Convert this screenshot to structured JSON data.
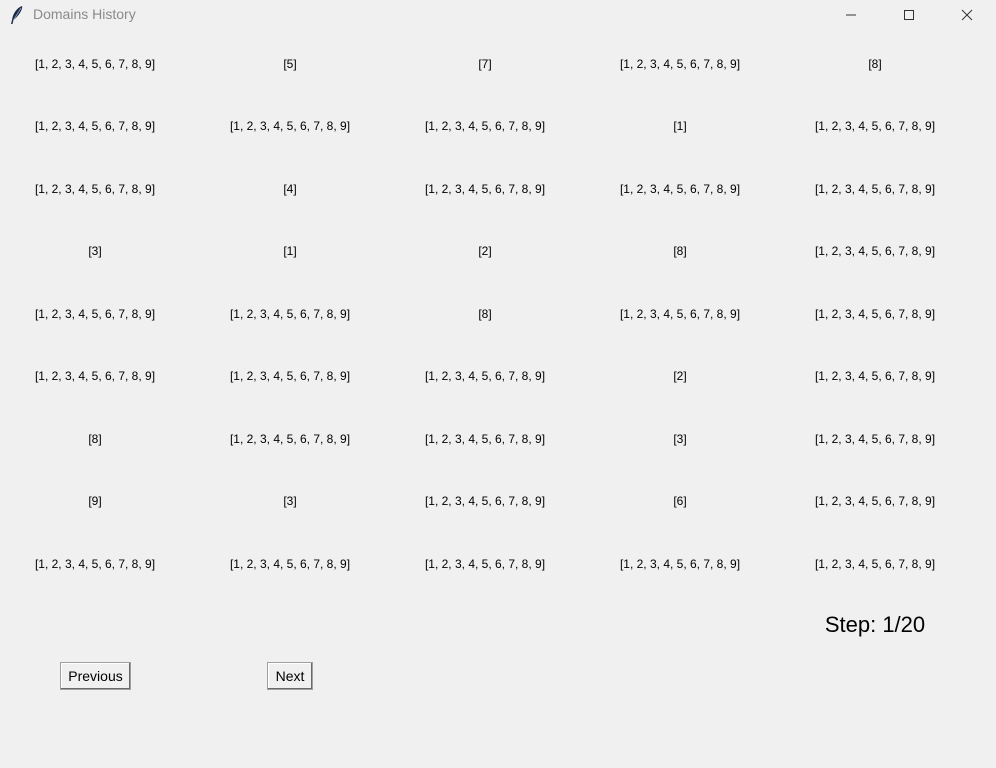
{
  "window": {
    "title": "Domains History"
  },
  "grid": {
    "rows": [
      [
        "[1, 2, 3, 4, 5, 6, 7, 8, 9]",
        "[5]",
        "[7]",
        "[1, 2, 3, 4, 5, 6, 7, 8, 9]",
        "[8]"
      ],
      [
        "[1, 2, 3, 4, 5, 6, 7, 8, 9]",
        "[1, 2, 3, 4, 5, 6, 7, 8, 9]",
        "[1, 2, 3, 4, 5, 6, 7, 8, 9]",
        "[1]",
        "[1, 2, 3, 4, 5, 6, 7, 8, 9]"
      ],
      [
        "[1, 2, 3, 4, 5, 6, 7, 8, 9]",
        "[4]",
        "[1, 2, 3, 4, 5, 6, 7, 8, 9]",
        "[1, 2, 3, 4, 5, 6, 7, 8, 9]",
        "[1, 2, 3, 4, 5, 6, 7, 8, 9]"
      ],
      [
        "[3]",
        "[1]",
        "[2]",
        "[8]",
        "[1, 2, 3, 4, 5, 6, 7, 8, 9]"
      ],
      [
        "[1, 2, 3, 4, 5, 6, 7, 8, 9]",
        "[1, 2, 3, 4, 5, 6, 7, 8, 9]",
        "[8]",
        "[1, 2, 3, 4, 5, 6, 7, 8, 9]",
        "[1, 2, 3, 4, 5, 6, 7, 8, 9]"
      ],
      [
        "[1, 2, 3, 4, 5, 6, 7, 8, 9]",
        "[1, 2, 3, 4, 5, 6, 7, 8, 9]",
        "[1, 2, 3, 4, 5, 6, 7, 8, 9]",
        "[2]",
        "[1, 2, 3, 4, 5, 6, 7, 8, 9]"
      ],
      [
        "[8]",
        "[1, 2, 3, 4, 5, 6, 7, 8, 9]",
        "[1, 2, 3, 4, 5, 6, 7, 8, 9]",
        "[3]",
        "[1, 2, 3, 4, 5, 6, 7, 8, 9]"
      ],
      [
        "[9]",
        "[3]",
        "[1, 2, 3, 4, 5, 6, 7, 8, 9]",
        "[6]",
        "[1, 2, 3, 4, 5, 6, 7, 8, 9]"
      ],
      [
        "[1, 2, 3, 4, 5, 6, 7, 8, 9]",
        "[1, 2, 3, 4, 5, 6, 7, 8, 9]",
        "[1, 2, 3, 4, 5, 6, 7, 8, 9]",
        "[1, 2, 3, 4, 5, 6, 7, 8, 9]",
        "[1, 2, 3, 4, 5, 6, 7, 8, 9]"
      ]
    ]
  },
  "step": {
    "label": "Step: 1/20"
  },
  "controls": {
    "previous_label": "Previous",
    "next_label": "Next"
  },
  "icons": {
    "app": "feather-icon",
    "minimize": "minimize-icon",
    "maximize": "maximize-icon",
    "close": "close-icon"
  }
}
